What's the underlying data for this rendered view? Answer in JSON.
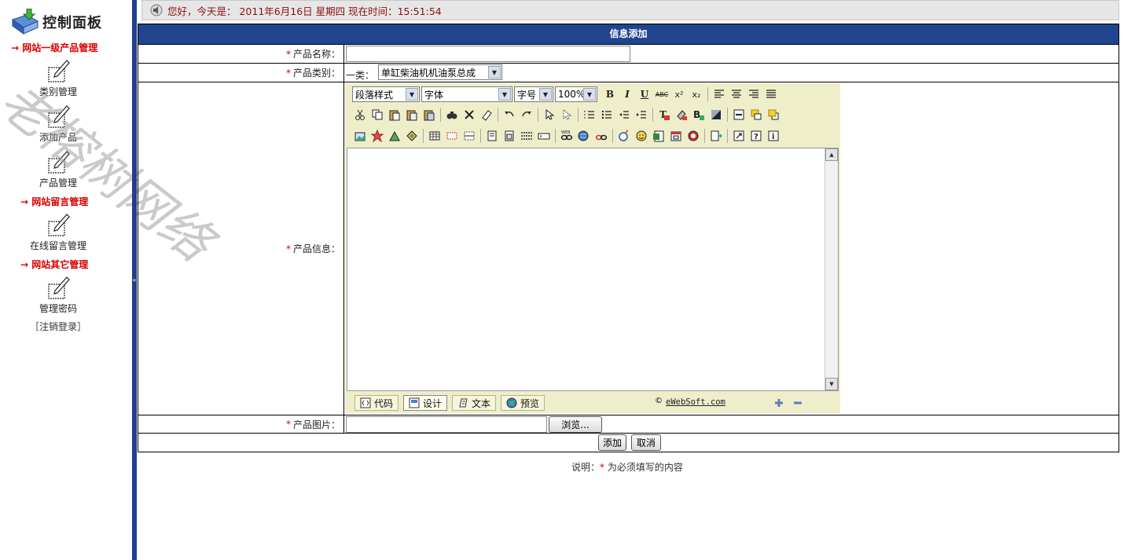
{
  "sidebar": {
    "panel_title": "控制面板",
    "sections": [
      {
        "title": "→ 网站一级产品管理",
        "items": [
          {
            "label": "类别管理",
            "icon": "edit-document-icon"
          },
          {
            "label": "添加产品",
            "icon": "edit-document-icon"
          },
          {
            "label": "产品管理",
            "icon": "edit-document-icon"
          }
        ]
      },
      {
        "title": "→ 网站留言管理",
        "items": [
          {
            "label": "在线留言管理",
            "icon": "edit-document-icon"
          }
        ]
      },
      {
        "title": "→ 网站其它管理",
        "items": [
          {
            "label": "管理密码",
            "icon": "edit-document-icon"
          }
        ]
      }
    ],
    "logout": "［注销登录］",
    "collapse_glyph": "«"
  },
  "watermark": "老榕树网络",
  "status_bar": {
    "text": "您好，今天是： 2011年6月16日 星期四 现在时间：15:51:54"
  },
  "form": {
    "header": "信息添加",
    "required_mark": "*",
    "name_label": "产品名称：",
    "name_value": "",
    "category_label": "产品类别：",
    "category_prefix": "一类：",
    "category_selected": "单缸柴油机机油泵总成",
    "info_label": "产品信息：",
    "image_label": "产品图片：",
    "image_value": "",
    "browse_button": "浏览...",
    "submit_button": "添加",
    "cancel_button": "取消"
  },
  "editor": {
    "paragraph_style": "段落样式",
    "font_family": "字体",
    "font_size": "字号",
    "zoom": "100%",
    "modes": [
      {
        "label": "代码",
        "icon": "code-icon"
      },
      {
        "label": "设计",
        "icon": "design-icon",
        "active": true
      },
      {
        "label": "文本",
        "icon": "text-icon"
      },
      {
        "label": "预览",
        "icon": "preview-globe-icon"
      }
    ],
    "brand_symbol": "©",
    "brand_link": "eWebSoft.com"
  },
  "note": {
    "prefix": "说明：",
    "star": "*",
    "suffix": " 为必须填写的内容"
  },
  "colors": {
    "header_blue": "#21448f",
    "required_red": "#d40000",
    "editor_bg": "#efeecb",
    "section_red": "#d80000"
  }
}
